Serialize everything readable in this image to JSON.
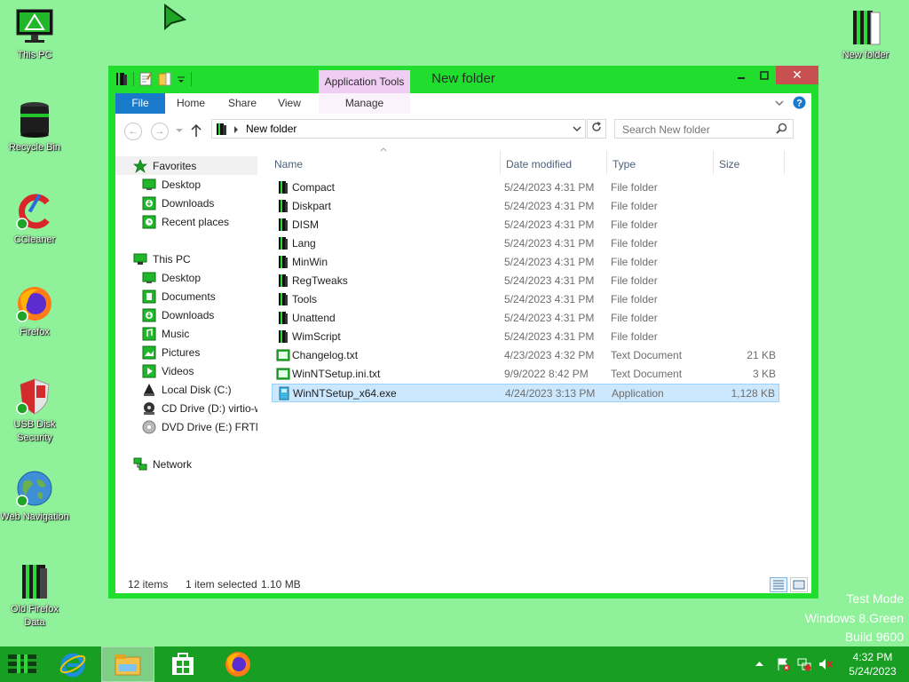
{
  "desktop": {
    "icons": [
      {
        "label": "This PC",
        "icon": "monitor-icon"
      },
      {
        "label": "Recycle Bin",
        "icon": "recycle-bin-icon"
      },
      {
        "label": "CCleaner",
        "icon": "ccleaner-icon"
      },
      {
        "label": "Firefox",
        "icon": "firefox-icon"
      },
      {
        "label": "USB Disk Security",
        "icon": "shield-icon"
      },
      {
        "label": "Web Navigation",
        "icon": "globe-icon"
      },
      {
        "label": "Old Firefox Data",
        "icon": "folder-icon"
      }
    ],
    "right_icon": {
      "label": "New folder",
      "icon": "folder-icon"
    },
    "watermark": [
      "Test Mode",
      "Windows 8.Green",
      "Build 9600"
    ]
  },
  "window": {
    "title": "New folder",
    "context_tab": "Application Tools",
    "ribbon_tabs": [
      "File",
      "Home",
      "Share",
      "View",
      "Manage"
    ],
    "address": "New folder",
    "search_placeholder": "Search New folder",
    "close_symbol": "✕",
    "nav": {
      "favorites": "Favorites",
      "favorites_items": [
        "Desktop",
        "Downloads",
        "Recent places"
      ],
      "this_pc": "This PC",
      "pc_items": [
        "Desktop",
        "Documents",
        "Downloads",
        "Music",
        "Pictures",
        "Videos",
        "Local Disk (C:)",
        "CD Drive (D:) virtio-w",
        "DVD Drive (E:) FRTM"
      ],
      "network": "Network"
    },
    "columns": {
      "name": "Name",
      "date": "Date modified",
      "type": "Type",
      "size": "Size"
    },
    "files": [
      {
        "name": "Compact",
        "date": "5/24/2023 4:31 PM",
        "type": "File folder",
        "size": "",
        "icon": "folder-icon"
      },
      {
        "name": "Diskpart",
        "date": "5/24/2023 4:31 PM",
        "type": "File folder",
        "size": "",
        "icon": "folder-icon"
      },
      {
        "name": "DISM",
        "date": "5/24/2023 4:31 PM",
        "type": "File folder",
        "size": "",
        "icon": "folder-icon"
      },
      {
        "name": "Lang",
        "date": "5/24/2023 4:31 PM",
        "type": "File folder",
        "size": "",
        "icon": "folder-icon"
      },
      {
        "name": "MinWin",
        "date": "5/24/2023 4:31 PM",
        "type": "File folder",
        "size": "",
        "icon": "folder-icon"
      },
      {
        "name": "RegTweaks",
        "date": "5/24/2023 4:31 PM",
        "type": "File folder",
        "size": "",
        "icon": "folder-icon"
      },
      {
        "name": "Tools",
        "date": "5/24/2023 4:31 PM",
        "type": "File folder",
        "size": "",
        "icon": "folder-icon"
      },
      {
        "name": "Unattend",
        "date": "5/24/2023 4:31 PM",
        "type": "File folder",
        "size": "",
        "icon": "folder-icon"
      },
      {
        "name": "WimScript",
        "date": "5/24/2023 4:31 PM",
        "type": "File folder",
        "size": "",
        "icon": "folder-icon"
      },
      {
        "name": "Changelog.txt",
        "date": "4/23/2023 4:32 PM",
        "type": "Text Document",
        "size": "21 KB",
        "icon": "text-file-icon"
      },
      {
        "name": "WinNTSetup.ini.txt",
        "date": "9/9/2022 8:42 PM",
        "type": "Text Document",
        "size": "3 KB",
        "icon": "text-file-icon"
      },
      {
        "name": "WinNTSetup_x64.exe",
        "date": "4/24/2023 3:13 PM",
        "type": "Application",
        "size": "1,128 KB",
        "icon": "exe-icon",
        "selected": true
      }
    ],
    "status": {
      "items": "12 items",
      "selected": "1 item selected",
      "size": "1.10 MB"
    }
  },
  "taskbar": {
    "time": "4:32 PM",
    "date": "5/24/2023",
    "items": [
      "start-icon",
      "internet-explorer-icon",
      "file-explorer-icon",
      "store-icon",
      "firefox-icon"
    ]
  },
  "colors": {
    "desktop": "#8ff29a",
    "window_frame": "#21dd2e",
    "taskbar": "#179e23",
    "file_tab": "#1979ca",
    "context_tab": "#f0cdf2",
    "selection": "#cce8ff"
  }
}
